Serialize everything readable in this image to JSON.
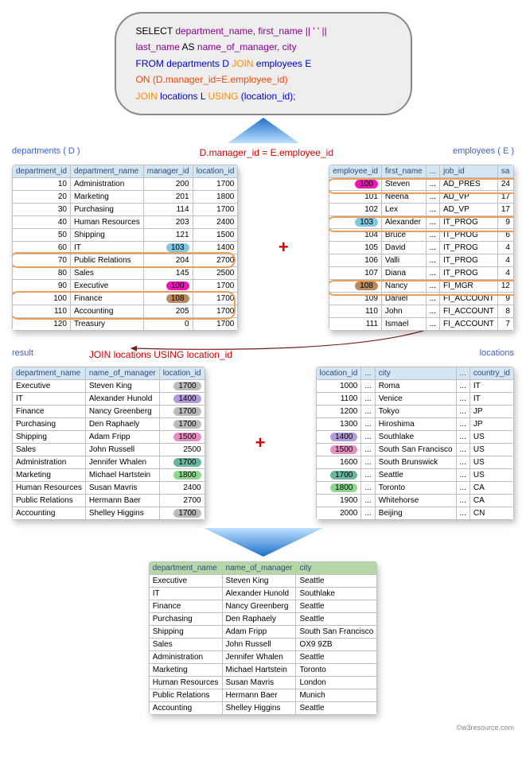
{
  "sql": {
    "l1a": "SELECT ",
    "l1b": "department_name, first_name || ' ' ||",
    "l2a": "last_name ",
    "l2b": "AS ",
    "l2c": "name_of_manager, city",
    "l3a": "FROM ",
    "l3b": "departments D ",
    "l3c": "JOIN ",
    "l3d": "employees E",
    "l4a": "ON ",
    "l4b": "(D.manager_id=E.employee_id)",
    "l5a": "JOIN ",
    "l5b": "locations L ",
    "l5c": "USING ",
    "l5d": "(location_id);"
  },
  "labels": {
    "dep": "departments ( D )",
    "emp": "employees ( E )",
    "cond": "D.manager_id = E.employee_id",
    "res": "result",
    "loc": "locations",
    "join2": "JOIN locations USING location_id"
  },
  "departments": {
    "headers": [
      "department_id",
      "department_name",
      "manager_id",
      "location_id"
    ],
    "rows": [
      [
        "10",
        "Administration",
        "200",
        "1700"
      ],
      [
        "20",
        "Marketing",
        "201",
        "1800"
      ],
      [
        "30",
        "Purchasing",
        "114",
        "1700"
      ],
      [
        "40",
        "Human Resources",
        "203",
        "2400"
      ],
      [
        "50",
        "Shipping",
        "121",
        "1500"
      ],
      [
        "60",
        "IT",
        "103",
        "1400"
      ],
      [
        "70",
        "Public Relations",
        "204",
        "2700"
      ],
      [
        "80",
        "Sales",
        "145",
        "2500"
      ],
      [
        "90",
        "Executive",
        "100",
        "1700"
      ],
      [
        "100",
        "Finance",
        "108",
        "1700"
      ],
      [
        "110",
        "Accounting",
        "205",
        "1700"
      ],
      [
        "120",
        "Treasury",
        "0",
        "1700"
      ]
    ]
  },
  "employees": {
    "headers": [
      "employee_id",
      "first_name",
      "...",
      "job_id",
      "sa"
    ],
    "rows": [
      [
        "100",
        "Steven",
        "...",
        "AD_PRES",
        "24"
      ],
      [
        "101",
        "Neena",
        "...",
        "AD_VP",
        "17"
      ],
      [
        "102",
        "Lex",
        "...",
        "AD_VP",
        "17"
      ],
      [
        "103",
        "Alexander",
        "...",
        "IT_PROG",
        "9"
      ],
      [
        "104",
        "Bruce",
        "...",
        "IT_PROG",
        "6"
      ],
      [
        "105",
        "David",
        "...",
        "IT_PROG",
        "4"
      ],
      [
        "106",
        "Valli",
        "...",
        "IT_PROG",
        "4"
      ],
      [
        "107",
        "Diana",
        "...",
        "IT_PROG",
        "4"
      ],
      [
        "108",
        "Nancy",
        "...",
        "FI_MGR",
        "12"
      ],
      [
        "109",
        "Daniel",
        "...",
        "FI_ACCOUNT",
        "9"
      ],
      [
        "110",
        "John",
        "...",
        "FI_ACCOUNT",
        "8"
      ],
      [
        "111",
        "Ismael",
        "...",
        "FI_ACCOUNT",
        "7"
      ]
    ]
  },
  "result": {
    "headers": [
      "department_name",
      "name_of_manager",
      "location_id"
    ],
    "rows": [
      [
        "Executive",
        "Steven King",
        "1700"
      ],
      [
        "IT",
        "Alexander Hunold",
        "1400"
      ],
      [
        "Finance",
        "Nancy Greenberg",
        "1700"
      ],
      [
        "Purchasing",
        "Den Raphaely",
        "1700"
      ],
      [
        "Shipping",
        "Adam Fripp",
        "1500"
      ],
      [
        "Sales",
        "John Russell",
        "2500"
      ],
      [
        "Administration",
        "Jennifer Whalen",
        "1700"
      ],
      [
        "Marketing",
        "Michael Hartstein",
        "1800"
      ],
      [
        "Human Resources",
        "Susan Mavris",
        "2400"
      ],
      [
        "Public Relations",
        "Hermann Baer",
        "2700"
      ],
      [
        "Accounting",
        "Shelley Higgins",
        "1700"
      ]
    ]
  },
  "locations": {
    "headers": [
      "location_id",
      "...",
      "city",
      "...",
      "country_id"
    ],
    "rows": [
      [
        "1000",
        "...",
        "Roma",
        "...",
        "IT"
      ],
      [
        "1100",
        "...",
        "Venice",
        "...",
        "IT"
      ],
      [
        "1200",
        "...",
        "Tokyo",
        "...",
        "JP"
      ],
      [
        "1300",
        "...",
        "Hiroshima",
        "...",
        "JP"
      ],
      [
        "1400",
        "...",
        "Southlake",
        "...",
        "US"
      ],
      [
        "1500",
        "...",
        "South San Francisco",
        "...",
        "US"
      ],
      [
        "1600",
        "...",
        "South Brunswick",
        "...",
        "US"
      ],
      [
        "1700",
        "...",
        "Seattle",
        "...",
        "US"
      ],
      [
        "1800",
        "...",
        "Toronto",
        "...",
        "CA"
      ],
      [
        "1900",
        "...",
        "Whitehorse",
        "...",
        "CA"
      ],
      [
        "2000",
        "...",
        "Beijing",
        "...",
        "CN"
      ]
    ]
  },
  "final": {
    "headers": [
      "department_name",
      "name_of_manager",
      "city"
    ],
    "rows": [
      [
        "Executive",
        "Steven King",
        "Seattle"
      ],
      [
        "IT",
        "Alexander Hunold",
        "Southlake"
      ],
      [
        "Finance",
        "Nancy Greenberg",
        "Seattle"
      ],
      [
        "Purchasing",
        "Den Raphaely",
        "Seattle"
      ],
      [
        "Shipping",
        "Adam Fripp",
        "South San Francisco"
      ],
      [
        "Sales",
        "John Russell",
        "OX9 9ZB"
      ],
      [
        "Administration",
        "Jennifer Whalen",
        "Seattle"
      ],
      [
        "Marketing",
        "Michael Hartstein",
        "Toronto"
      ],
      [
        "Human Resources",
        "Susan Mavris",
        "London"
      ],
      [
        "Public Relations",
        "Hermann Baer",
        "Munich"
      ],
      [
        "Accounting",
        "Shelley Higgins",
        "Seattle"
      ]
    ]
  },
  "footer": "©w3resource.com",
  "highlights": {
    "dep_mgr": {
      "5": "hl-blue",
      "8": "hl-pink",
      "9": "hl-brown"
    },
    "emp_id": {
      "0": "hl-pink",
      "3": "hl-blue",
      "8": "hl-brown"
    },
    "res_loc": {
      "0": "hl-grey",
      "1": "hl-purple",
      "2": "hl-grey",
      "3": "hl-grey",
      "4": "hl-mpink",
      "6": "hl-teal",
      "7": "hl-green",
      "10": "hl-grey"
    },
    "loc_id": {
      "4": "hl-purple",
      "5": "hl-mpink",
      "7": "hl-teal",
      "8": "hl-green"
    }
  }
}
